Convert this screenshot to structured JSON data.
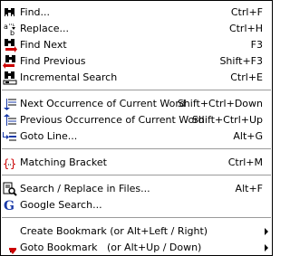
{
  "menu": {
    "items": [
      {
        "label": "Find...",
        "shortcut": "Ctrl+F",
        "icon": "binoculars-icon"
      },
      {
        "label": "Replace...",
        "shortcut": "Ctrl+H",
        "icon": "replace-icon"
      },
      {
        "label": "Find Next",
        "shortcut": "F3",
        "icon": "find-next-icon"
      },
      {
        "label": "Find Previous",
        "shortcut": "Shift+F3",
        "icon": "find-previous-icon"
      },
      {
        "label": "Incremental Search",
        "shortcut": "Ctrl+E",
        "icon": "incremental-search-icon"
      },
      {
        "label": "Next Occurrence of Current Word",
        "shortcut": "Shift+Ctrl+Down",
        "icon": "next-occurrence-icon"
      },
      {
        "label": "Previous Occurrence of Current Word",
        "shortcut": "Shift+Ctrl+Up",
        "icon": "previous-occurrence-icon"
      },
      {
        "label": "Goto Line...",
        "shortcut": "Alt+G",
        "icon": "goto-line-icon"
      },
      {
        "label": "Matching Bracket",
        "shortcut": "Ctrl+M",
        "icon": "matching-bracket-icon"
      },
      {
        "label": "Search / Replace in Files...",
        "shortcut": "Alt+F",
        "icon": "search-files-icon"
      },
      {
        "label": "Google Search...",
        "shortcut": "",
        "icon": "google-icon"
      },
      {
        "label": "Create Bookmark (or Alt+Left / Right)",
        "shortcut": "",
        "icon": ""
      },
      {
        "label": "Goto Bookmark   (or Alt+Up / Down)",
        "shortcut": "",
        "icon": "goto-bookmark-icon"
      }
    ]
  },
  "colors": {
    "icon_red": "#cc0000",
    "icon_blue": "#1a3aa8",
    "separator": "#9a9a9a"
  }
}
